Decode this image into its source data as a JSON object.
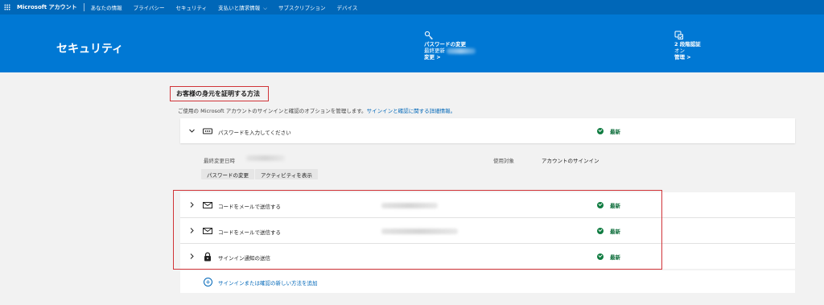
{
  "topnav": {
    "brand": "Microsoft アカウント",
    "items": [
      {
        "label": "あなたの情報"
      },
      {
        "label": "プライバシー"
      },
      {
        "label": "セキュリティ"
      },
      {
        "label": "支払いと請求情報",
        "chevron": true
      },
      {
        "label": "サブスクリプション"
      },
      {
        "label": "デバイス"
      }
    ]
  },
  "hero": {
    "title": "セキュリティ",
    "password": {
      "title": "パスワードの変更",
      "subtitle": "最終更新",
      "link": "変更 >",
      "icon": "key-icon"
    },
    "twofactor": {
      "title": "2 段階認証",
      "subtitle": "オン",
      "link": "管理 >",
      "icon": "shield-check-icon"
    }
  },
  "section": {
    "heading": "お客様の身元を証明する方法",
    "description": "ご使用の Microsoft アカウントのサインインと確認のオプションを管理します。",
    "description_link": "サインインと確認に関する詳細情報。"
  },
  "methods": {
    "password": {
      "label": "パスワードを入力してください",
      "status": "最新",
      "details": {
        "last_changed_label": "最終変更日時",
        "usage_label": "使用対象",
        "usage_value": "アカウントのサインイン",
        "change_button": "パスワードの変更",
        "activity_button": "アクティビティを表示"
      }
    },
    "email1": {
      "label": "コードをメールで送信する",
      "status": "最新",
      "icon": "mail-icon"
    },
    "email2": {
      "label": "コードをメールで送信する",
      "status": "最新",
      "icon": "mail-icon"
    },
    "notify": {
      "label": "サインイン通知の送信",
      "status": "最新",
      "icon": "lock-icon"
    },
    "add": {
      "label": "サインインまたは確認の新しい方法を追加"
    }
  },
  "colors": {
    "topbar": "#0067b8",
    "hero": "#0078d4",
    "highlight_border": "#d13438",
    "status_green": "#107c41",
    "link": "#0067b8"
  }
}
